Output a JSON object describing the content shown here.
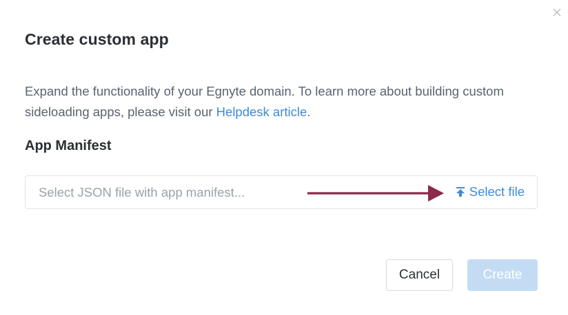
{
  "dialog": {
    "title": "Create custom app",
    "description_text": "Expand the functionality of your Egnyte domain. To learn more about building custom sideloading apps, please visit our ",
    "helpdesk_link": "Helpdesk article",
    "description_end": ".",
    "close_icon": "close-icon"
  },
  "manifest": {
    "label": "App Manifest",
    "placeholder": "Select JSON file with app manifest...",
    "select_file_label": "Select file",
    "upload_icon": "upload-icon"
  },
  "annotation": {
    "arrow_color": "#8b2a4a"
  },
  "footer": {
    "cancel_label": "Cancel",
    "create_label": "Create",
    "create_disabled": true
  },
  "colors": {
    "accent": "#3b8bd6",
    "create_disabled_bg": "#c3dcf4"
  }
}
